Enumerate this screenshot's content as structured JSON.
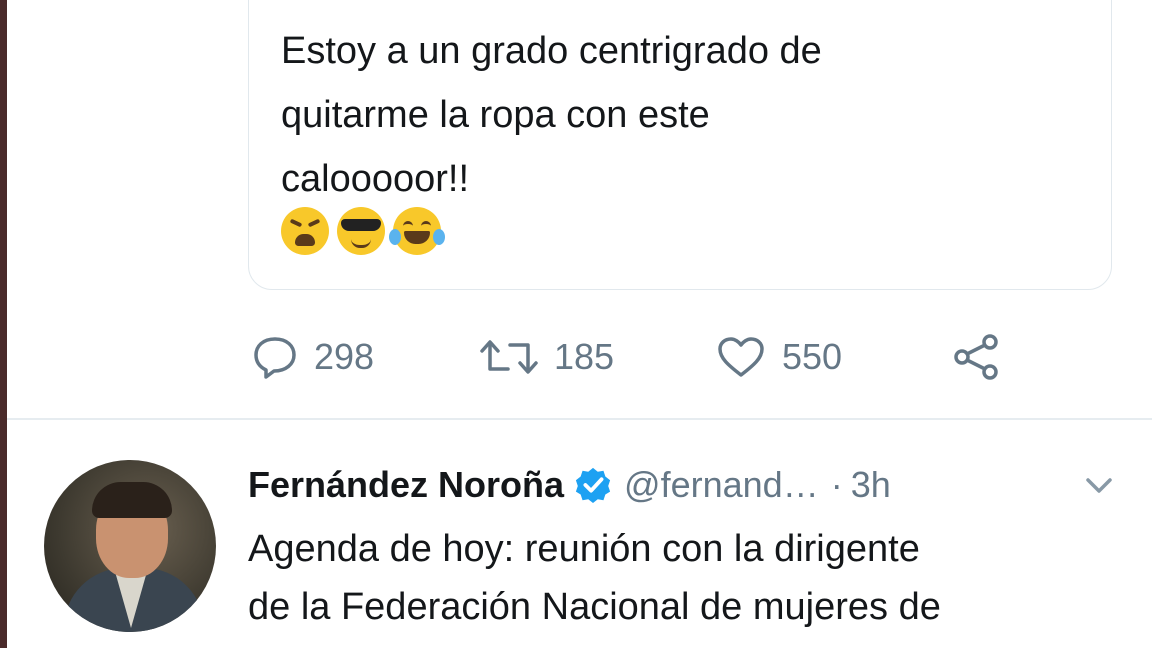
{
  "quoted_tweet": {
    "text_lines": [
      "Estoy a un grado centrigrado de",
      "quitarme la ropa con este",
      "calooooor!!"
    ],
    "emojis": [
      "weary-face",
      "smiling-face-with-sunglasses",
      "face-with-tears-of-joy"
    ]
  },
  "actions": {
    "reply_count": "298",
    "retweet_count": "185",
    "like_count": "550"
  },
  "tweet": {
    "name": "Fernández Noroña",
    "handle": "@fernand…",
    "separator": "·",
    "time": "3h",
    "text_lines": [
      "Agenda de hoy: reunión con la dirigente",
      "de la Federación Nacional de mujeres de"
    ]
  },
  "colors": {
    "text": "#14171a",
    "muted": "#657786",
    "verified": "#1da1f2",
    "border": "#e1e8ed"
  }
}
